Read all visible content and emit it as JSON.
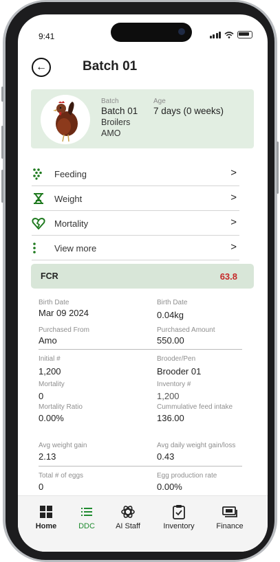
{
  "status_bar": {
    "time": "9:41"
  },
  "header": {
    "title": "Batch 01"
  },
  "batch_card": {
    "batch_label": "Batch",
    "batch_value": "Batch 01",
    "type": "Broilers",
    "supplier": "AMO",
    "age_label": "Age",
    "age_value": "7 days (0 weeks)"
  },
  "menu": [
    {
      "label": "Feeding",
      "icon": "feeding-dots-icon"
    },
    {
      "label": "Weight",
      "icon": "scale-icon"
    },
    {
      "label": "Mortality",
      "icon": "broken-heart-icon"
    },
    {
      "label": "View more",
      "icon": "more-dots-icon"
    }
  ],
  "fcr": {
    "label": "FCR",
    "value": "63.8"
  },
  "details": {
    "birth_date_left": {
      "label": "Birth Date",
      "value": "Mar 09 2024"
    },
    "birth_date_right": {
      "label": "Birth Date",
      "value": "0.04kg"
    },
    "purchased_from": {
      "label": "Purchased From",
      "value": "Amo"
    },
    "purchased_amount": {
      "label": "Purchased Amount",
      "value": "550.00"
    },
    "initial": {
      "label": "Initial #",
      "value": "1,200"
    },
    "brooder_pen": {
      "label": "Brooder/Pen",
      "value": "Brooder 01"
    },
    "mortality": {
      "label": "Mortality",
      "value": "0"
    },
    "inventory": {
      "label": "Inventory #",
      "value": "1,200"
    },
    "mortality_ratio": {
      "label": "Mortality Ratio",
      "value": "0.00%"
    },
    "cumulative_feed": {
      "label": "Cummulative feed intake",
      "value": "136.00"
    },
    "avg_weight_gain": {
      "label": "Avg weight gain",
      "value": "2.13"
    },
    "avg_daily_weight": {
      "label": "Avg daily weight gain/loss",
      "value": "0.43"
    },
    "total_eggs": {
      "label": "Total # of eggs",
      "value": "0"
    },
    "egg_rate": {
      "label": "Egg production rate",
      "value": "0.00%"
    }
  },
  "tabs": [
    {
      "label": "Home",
      "icon": "grid-icon"
    },
    {
      "label": "DDC",
      "icon": "list-icon"
    },
    {
      "label": "AI Staff",
      "icon": "ai-knot-icon"
    },
    {
      "label": "Inventory",
      "icon": "clipboard-check-icon"
    },
    {
      "label": "Finance",
      "icon": "cash-icon"
    }
  ],
  "colors": {
    "accent": "#1e8a2e",
    "card_bg": "#e2eee2",
    "fcr_bg": "#d8e6d8",
    "fcr_value": "#c62828"
  }
}
